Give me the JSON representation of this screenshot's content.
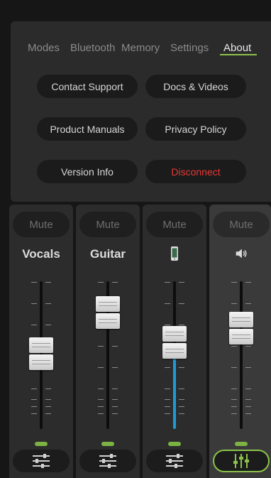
{
  "nav": {
    "tabs": [
      "Modes",
      "Bluetooth",
      "Memory",
      "Settings",
      "About"
    ],
    "active_tab": "About"
  },
  "about": {
    "buttons": [
      {
        "label": "Contact Support"
      },
      {
        "label": "Docs & Videos"
      },
      {
        "label": "Product Manuals"
      },
      {
        "label": "Privacy Policy"
      },
      {
        "label": "Version Info"
      },
      {
        "label": "Disconnect",
        "color": "#e53935"
      }
    ]
  },
  "mixer": {
    "channels": [
      {
        "mute_label": "Mute",
        "name": "Vocals",
        "icon": null,
        "fader_level": 0.5,
        "selected": false
      },
      {
        "mute_label": "Mute",
        "name": "Guitar",
        "icon": null,
        "fader_level": 0.87,
        "selected": false
      },
      {
        "mute_label": "Mute",
        "name": "",
        "icon": "phone-icon",
        "fader_level": 0.6,
        "selected": false
      },
      {
        "mute_label": "Mute",
        "name": "",
        "icon": "speaker-icon",
        "fader_level": 0.73,
        "selected": true
      }
    ]
  },
  "colors": {
    "accent_green": "#8bc34a",
    "fader_fill_blue": "#1e9ad6",
    "danger_red": "#e53935"
  }
}
